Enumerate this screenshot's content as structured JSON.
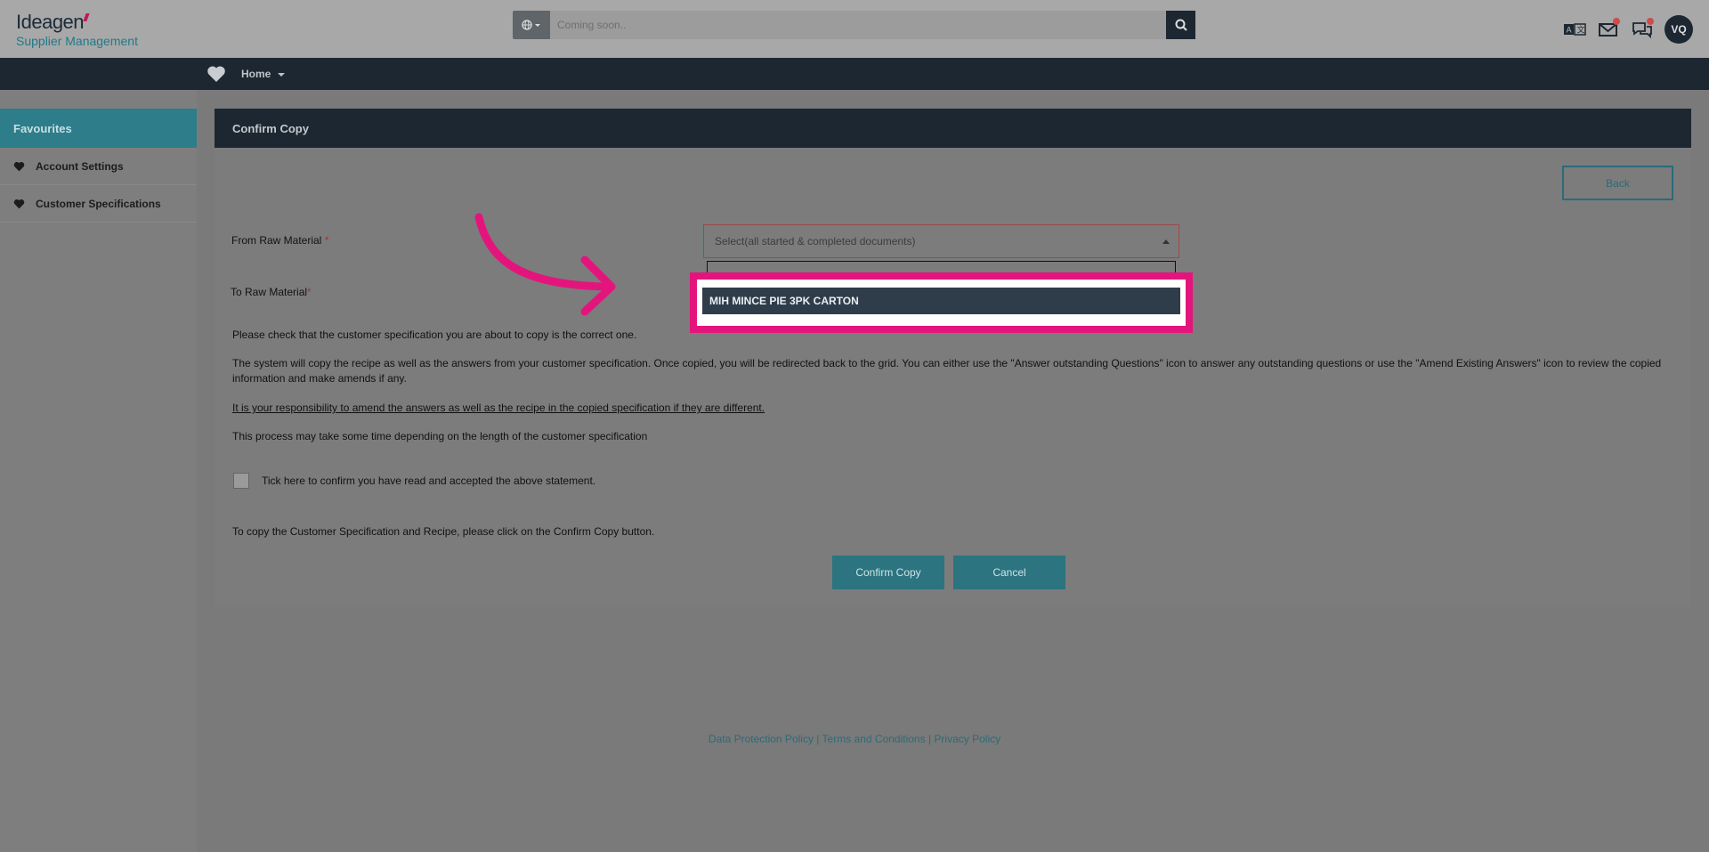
{
  "header": {
    "brand": "Ideagen",
    "subtitle": "Supplier Management",
    "search_placeholder": "Coming soon..",
    "avatar_initials": "VQ"
  },
  "nav": {
    "home_label": "Home"
  },
  "sidebar": {
    "title": "Favourites",
    "items": [
      {
        "label": "Account Settings"
      },
      {
        "label": "Customer Specifications"
      }
    ]
  },
  "panel": {
    "title": "Confirm Copy",
    "back_label": "Back",
    "from_label": "From Raw Material",
    "to_label": "To Raw Material",
    "required_mark": "*",
    "select_placeholder": "Select(all started & completed documents)",
    "dropdown_option": "MIH MINCE PIE 3PK CARTON",
    "para1": "Please check that the customer specification you are about to copy is the correct one.",
    "para2": "The system will copy the recipe as well as the answers from your customer specification. Once copied, you will be redirected back to the grid. You can either use the \"Answer outstanding Questions\" icon to answer any outstanding questions or use the \"Amend Existing Answers\" icon to review the copied information and make amends if any.",
    "para3": "It is your responsibility to amend the answers as well as the recipe in the copied specification if they are different.",
    "para4": "This process may take some time depending on the length of the customer specification",
    "checkbox_label": "Tick here to confirm you have read and accepted the above statement.",
    "para5": "To copy the Customer Specification and Recipe, please click on the Confirm Copy button.",
    "confirm_label": "Confirm Copy",
    "cancel_label": "Cancel"
  },
  "footer": {
    "link1": "Data Protection Policy",
    "sep": "|",
    "link2": "Terms and Conditions",
    "link3": "Privacy Policy"
  },
  "colors": {
    "accent": "#2b7480",
    "navbar": "#1c2731",
    "highlight": "#e3157d"
  }
}
